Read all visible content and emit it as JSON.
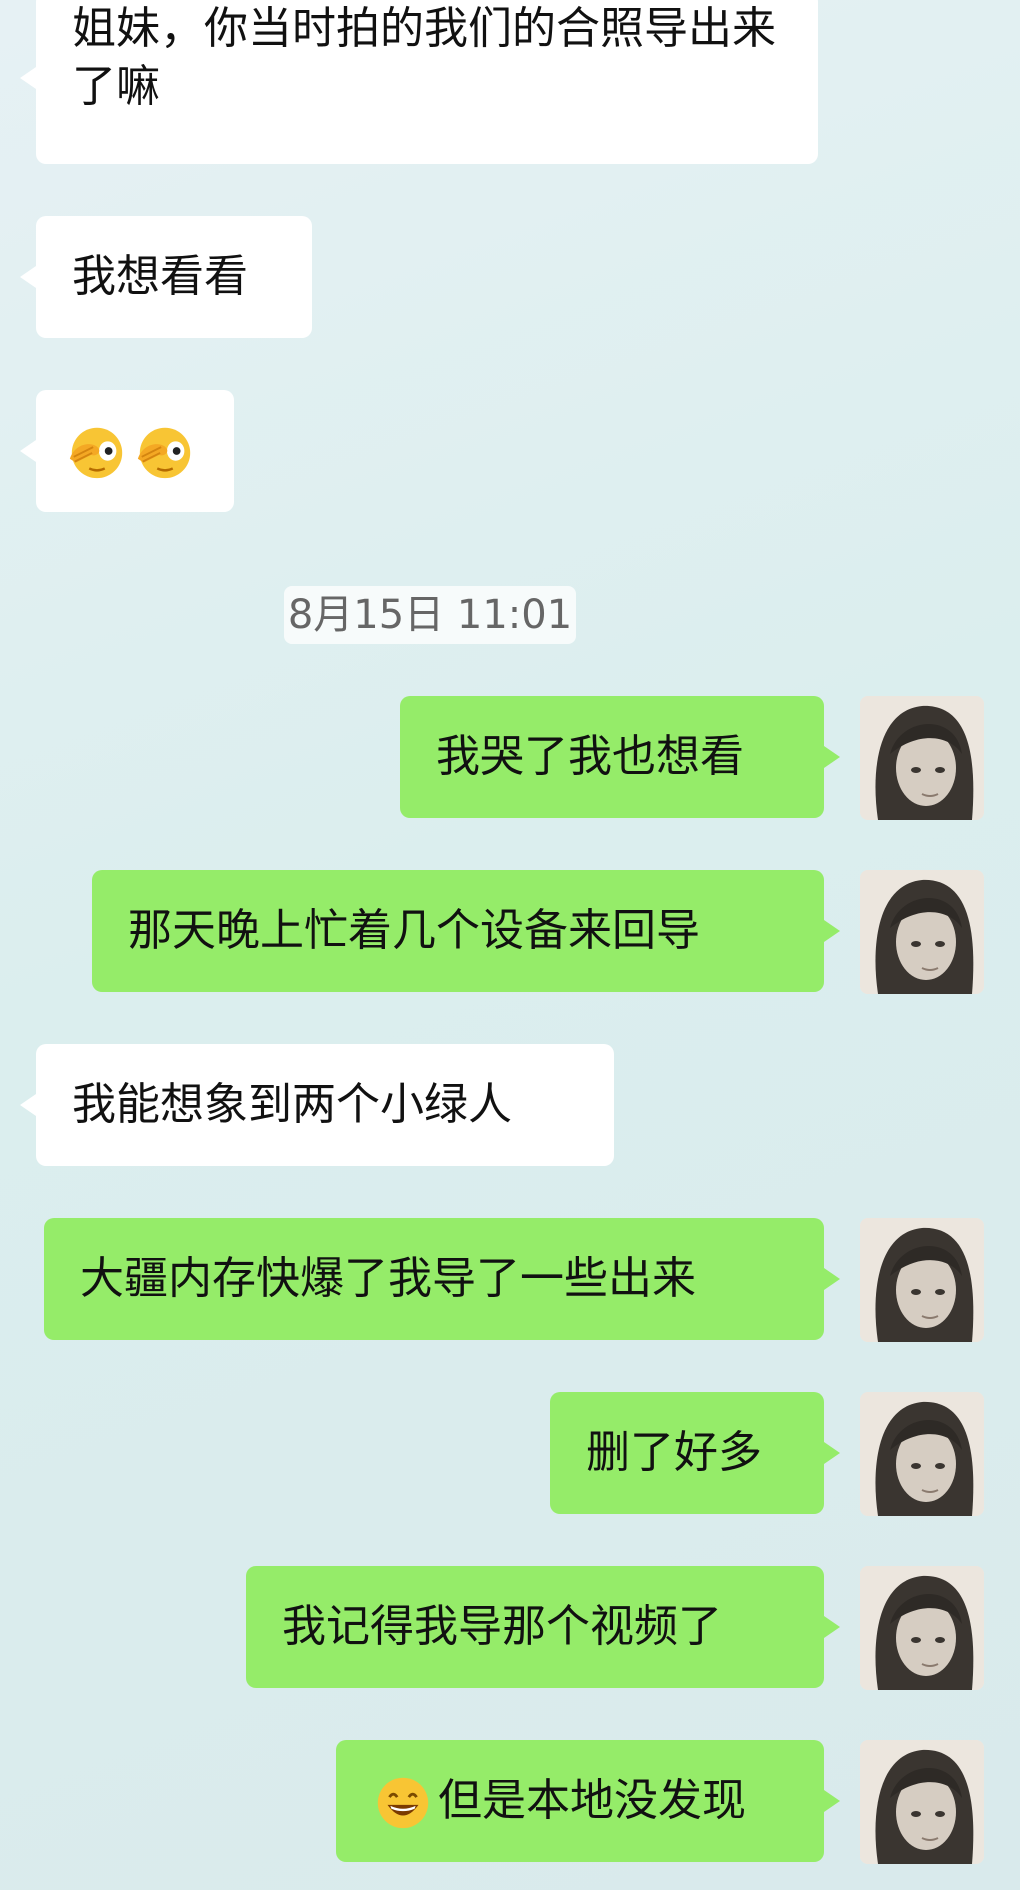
{
  "messages": [
    {
      "side": "in",
      "text": "姐妹，你当时拍的我们的合照导出来了嘛"
    },
    {
      "side": "in",
      "text": "我想看看"
    },
    {
      "side": "in",
      "text": ""
    },
    {
      "side": "out",
      "text": "我哭了我也想看"
    },
    {
      "side": "out",
      "text": "那天晚上忙着几个设备来回导"
    },
    {
      "side": "in",
      "text": "我能想象到两个小绿人"
    },
    {
      "side": "out",
      "text": "大疆内存快爆了我导了一些出来"
    },
    {
      "side": "out",
      "text": "删了好多"
    },
    {
      "side": "out",
      "text": "我记得我导那个视频了"
    },
    {
      "side": "out",
      "text": "但是本地没发现"
    }
  ],
  "timestamp": "8月15日 11:01",
  "emoji_names": [
    "peek-emoji-icon",
    "peek-emoji-icon",
    "grin-emoji-icon"
  ],
  "colors": {
    "incoming_bubble": "#ffffff",
    "outgoing_bubble": "#95ec69"
  }
}
